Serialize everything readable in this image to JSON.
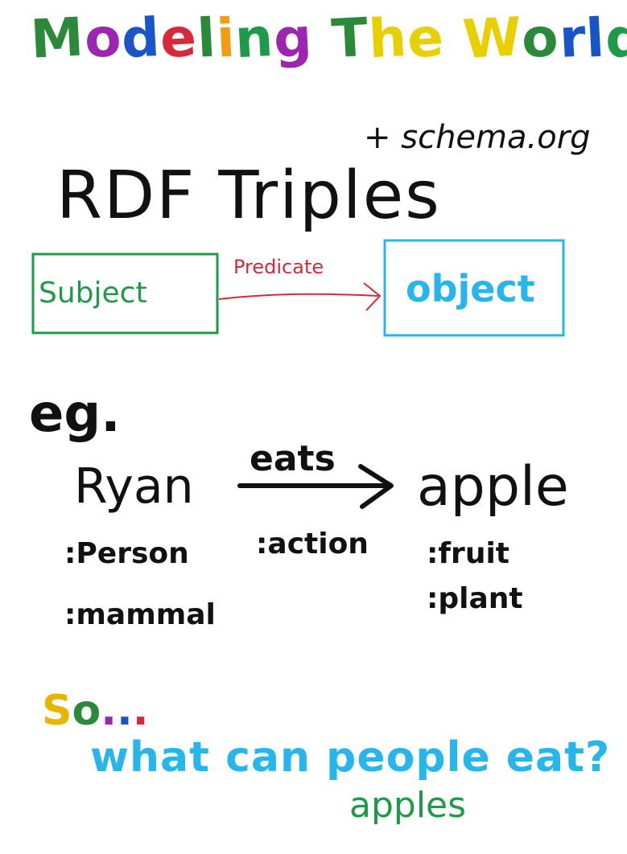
{
  "title": {
    "text": "Modeling The World",
    "letter_colors": [
      "#2a8a3a",
      "#9b27b0",
      "#1a55c8",
      "#d8283a",
      "#2a8a3a",
      "#f39c12",
      "#1f9a4a",
      "#9b27b0",
      "#2a8a3a",
      "#e8d000",
      "#e8d000",
      "#e8d000",
      "#2a8a3a",
      "#1a55c8",
      "#1a55c8",
      "#1f9a4a",
      "#9b27b0",
      "#c2185b"
    ]
  },
  "note": "+ schema.org",
  "heading": "RDF Triples",
  "diagram": {
    "subject": "Subject",
    "predicate": "Predicate",
    "object": "object",
    "colors": {
      "subject": "#1f9a4a",
      "predicate": "#d8283a",
      "object": "#27b6ec"
    }
  },
  "example": {
    "label": "eg.",
    "subject": "Ryan",
    "predicate": "eats",
    "object": "apple",
    "subject_types": [
      ":Person",
      ":mammal"
    ],
    "predicate_types": [
      ":action"
    ],
    "object_types": [
      ":fruit",
      ":plant"
    ]
  },
  "conclusion": {
    "so": "So...",
    "so_colors": [
      "#e8b400",
      "#2a8a3a",
      "#9b27b0",
      "#1a55c8",
      "#d8283a"
    ],
    "question": "what can people eat?",
    "answer": "apples"
  }
}
